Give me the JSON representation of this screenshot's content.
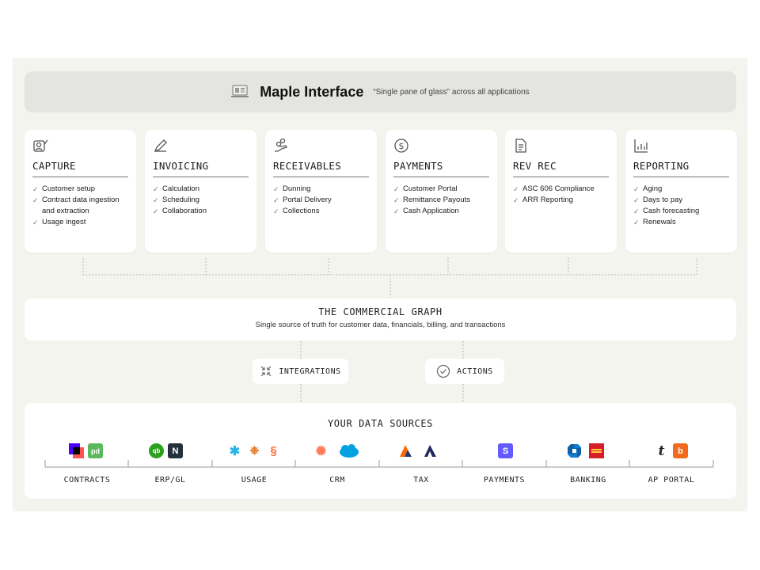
{
  "banner": {
    "title": "Maple Interface",
    "subtitle": "“Single pane of glass” across all applications",
    "icon": "laptop-icon"
  },
  "cards": [
    {
      "title": "CAPTURE",
      "icon": "capture-icon",
      "items": [
        "Customer setup",
        "Contract data ingestion",
        "and extraction",
        "Usage ingest"
      ]
    },
    {
      "title": "INVOICING",
      "icon": "pen-icon",
      "items": [
        "Calculation",
        "Scheduling",
        "Collaboration"
      ]
    },
    {
      "title": "RECEIVABLES",
      "icon": "hand-coins-icon",
      "items": [
        "Dunning",
        "Portal Delivery",
        "Collections"
      ]
    },
    {
      "title": "PAYMENTS",
      "icon": "dollar-circle-icon",
      "items": [
        "Customer Portal",
        "Remittance Payouts",
        "Cash Application"
      ]
    },
    {
      "title": "REV REC",
      "icon": "document-icon",
      "items": [
        "ASC 606 Compliance",
        "ARR Reporting"
      ]
    },
    {
      "title": "REPORTING",
      "icon": "bar-chart-icon",
      "items": [
        "Aging",
        "Days to pay",
        "Cash forecasting",
        "Renewals"
      ]
    }
  ],
  "graph": {
    "title": "THE COMMERCIAL GRAPH",
    "subtitle": "Single source of truth for customer data, financials, billing, and transactions"
  },
  "integrations": {
    "label": "INTEGRATIONS",
    "icon": "arrows-in-icon"
  },
  "actions": {
    "label": "ACTIONS",
    "icon": "check-circle-icon"
  },
  "sources": {
    "title": "YOUR DATA SOURCES",
    "categories": [
      "CONTRACTS",
      "ERP/GL",
      "USAGE",
      "CRM",
      "TAX",
      "PAYMENTS",
      "BANKING",
      "AP PORTAL"
    ],
    "logo_text": {
      "pd": "pd",
      "qb": "qb",
      "n": "N",
      "s": "S",
      "t": "t",
      "b": "b"
    }
  },
  "colors": {
    "canvas": "#f4f4ef",
    "banner": "#e4e5e0",
    "card": "#ffffff",
    "dotted": "#b8b8b2"
  }
}
